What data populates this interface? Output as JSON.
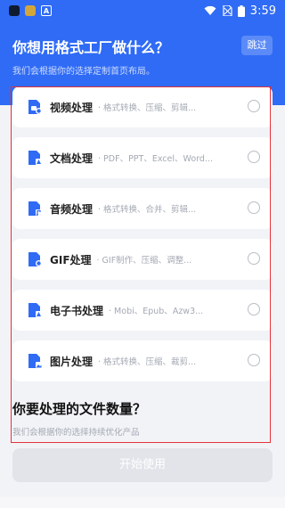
{
  "status_bar": {
    "time": "3:59",
    "icons": [
      "app-icon",
      "app-icon-2",
      "a-icon",
      "wifi-icon",
      "no-sim-icon",
      "battery-icon"
    ]
  },
  "header": {
    "title": "你想用格式工厂做什么？",
    "skip_label": "跳过",
    "subtitle": "我们会根据你的选择定制首页布局。"
  },
  "options": [
    {
      "title": "视频处理",
      "desc": "· 格式转换、压缩、剪辑...",
      "icon": "video-file-icon"
    },
    {
      "title": "文档处理",
      "desc": "· PDF、PPT、Excel、Word...",
      "icon": "document-file-icon"
    },
    {
      "title": "音频处理",
      "desc": "· 格式转换、合并、剪辑...",
      "icon": "audio-file-icon"
    },
    {
      "title": "GIF处理",
      "desc": "· GIF制作、压缩、调整...",
      "icon": "gif-file-icon"
    },
    {
      "title": "电子书处理",
      "desc": "· Mobi、Epub、Azw3...",
      "icon": "ebook-file-icon"
    },
    {
      "title": "图片处理",
      "desc": "· 格式转换、压缩、裁剪...",
      "icon": "image-file-icon"
    }
  ],
  "section2": {
    "title": "你要处理的文件数量？",
    "subtitle": "我们会根据你的选择持续优化产品"
  },
  "start_button": {
    "label": "开始使用"
  },
  "colors": {
    "primary": "#2f6bf5",
    "highlight": "#e53238",
    "background": "#f2f3f7"
  }
}
